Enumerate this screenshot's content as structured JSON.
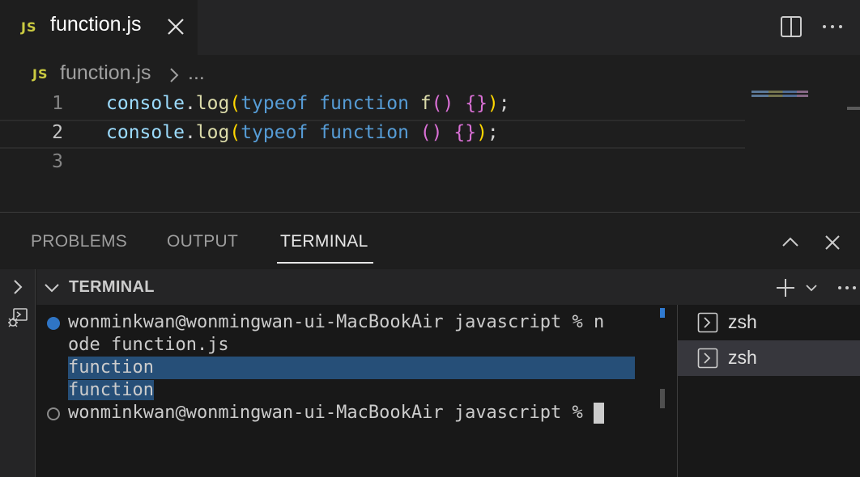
{
  "tab": {
    "badge": "JS",
    "filename": "function.js"
  },
  "breadcrumb": {
    "badge": "JS",
    "filename": "function.js",
    "more": "..."
  },
  "editor": {
    "line_numbers": [
      "1",
      "2",
      "3"
    ],
    "active_line": 2,
    "lines": [
      {
        "tokens": [
          "console",
          ".",
          "log",
          "(",
          "typeof",
          " ",
          "function",
          " ",
          "f",
          "()",
          " ",
          "{}",
          ")",
          ";"
        ]
      },
      {
        "tokens": [
          "console",
          ".",
          "log",
          "(",
          "typeof",
          " ",
          "function",
          " ",
          "()",
          " ",
          "{}",
          ")",
          ";"
        ]
      },
      {
        "tokens": []
      }
    ]
  },
  "panel": {
    "tabs": [
      "PROBLEMS",
      "OUTPUT",
      "TERMINAL"
    ],
    "active_tab": "TERMINAL"
  },
  "terminal": {
    "title": "TERMINAL",
    "lines": [
      "wonminkwan@wonmingwan-ui-MacBookAir javascript % n",
      "ode function.js",
      "function",
      "function",
      "wonminkwan@wonmingwan-ui-MacBookAir javascript % "
    ],
    "instances": [
      {
        "label": "zsh",
        "active": false
      },
      {
        "label": "zsh",
        "active": true
      }
    ]
  },
  "colors": {
    "js_badge": "#cbcb41",
    "keyword": "#569cd6",
    "function_name": "#dcdcaa",
    "variable": "#9cdcfe",
    "selection": "#264f78",
    "status_dot_success": "#3794ff"
  },
  "icons": [
    "close-icon",
    "split-editor-icon",
    "more-actions-icon",
    "chevron-right-icon",
    "chevron-up-icon",
    "terminal-icon",
    "debug-console-icon",
    "chevron-down-icon",
    "plus-icon"
  ]
}
